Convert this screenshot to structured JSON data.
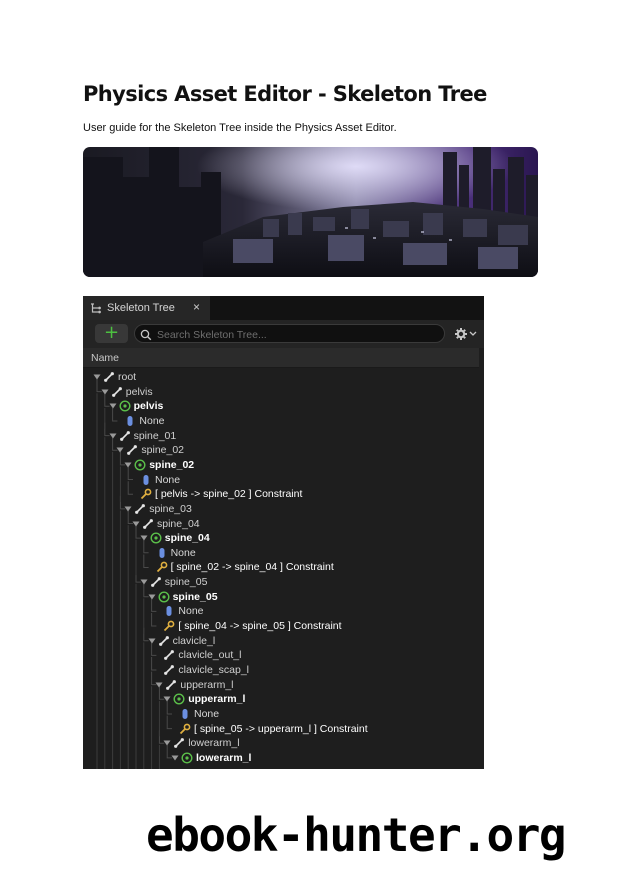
{
  "document": {
    "title": "Physics Asset Editor - Skeleton Tree",
    "subtitle": "User guide for the Skeleton Tree inside the Physics Asset Editor."
  },
  "panel": {
    "tab_label": "Skeleton Tree",
    "tab_close": "×",
    "add_label": "+",
    "search_placeholder": "Search Skeleton Tree...",
    "column_header": "Name"
  },
  "tree": [
    {
      "label": "root",
      "type": "bone",
      "depth": 0,
      "arrow": true
    },
    {
      "label": "pelvis",
      "type": "bone",
      "depth": 1,
      "arrow": true
    },
    {
      "label": "pelvis",
      "type": "body",
      "depth": 2,
      "arrow": true
    },
    {
      "label": "None",
      "type": "shape",
      "depth": 3,
      "arrow": false
    },
    {
      "label": "spine_01",
      "type": "bone",
      "depth": 2,
      "arrow": true
    },
    {
      "label": "spine_02",
      "type": "bone",
      "depth": 3,
      "arrow": true
    },
    {
      "label": "spine_02",
      "type": "body",
      "depth": 4,
      "arrow": true
    },
    {
      "label": "None",
      "type": "shape",
      "depth": 5,
      "arrow": false
    },
    {
      "label": "[ pelvis -> spine_02 ] Constraint",
      "type": "constraint",
      "depth": 5,
      "arrow": false
    },
    {
      "label": "spine_03",
      "type": "bone",
      "depth": 4,
      "arrow": true
    },
    {
      "label": "spine_04",
      "type": "bone",
      "depth": 5,
      "arrow": true
    },
    {
      "label": "spine_04",
      "type": "body",
      "depth": 6,
      "arrow": true
    },
    {
      "label": "None",
      "type": "shape",
      "depth": 7,
      "arrow": false
    },
    {
      "label": "[ spine_02 -> spine_04 ] Constraint",
      "type": "constraint",
      "depth": 7,
      "arrow": false
    },
    {
      "label": "spine_05",
      "type": "bone",
      "depth": 6,
      "arrow": true
    },
    {
      "label": "spine_05",
      "type": "body",
      "depth": 7,
      "arrow": true
    },
    {
      "label": "None",
      "type": "shape",
      "depth": 8,
      "arrow": false
    },
    {
      "label": "[ spine_04 -> spine_05 ] Constraint",
      "type": "constraint",
      "depth": 8,
      "arrow": false
    },
    {
      "label": "clavicle_l",
      "type": "bone",
      "depth": 7,
      "arrow": true
    },
    {
      "label": "clavicle_out_l",
      "type": "bone",
      "depth": 8,
      "arrow": false
    },
    {
      "label": "clavicle_scap_l",
      "type": "bone",
      "depth": 8,
      "arrow": false
    },
    {
      "label": "upperarm_l",
      "type": "bone",
      "depth": 8,
      "arrow": true
    },
    {
      "label": "upperarm_l",
      "type": "body",
      "depth": 9,
      "arrow": true
    },
    {
      "label": "None",
      "type": "shape",
      "depth": 10,
      "arrow": false
    },
    {
      "label": "[ spine_05 -> upperarm_l ] Constraint",
      "type": "constraint",
      "depth": 10,
      "arrow": false
    },
    {
      "label": "lowerarm_l",
      "type": "bone",
      "depth": 9,
      "arrow": true
    },
    {
      "label": "lowerarm_l",
      "type": "body",
      "depth": 10,
      "arrow": true
    }
  ],
  "watermark": "ebook-hunter.org",
  "colors": {
    "panel_bg": "#1e1e1e",
    "add_green": "#4cc040",
    "body_icon_green": "#5bbf4a",
    "shape_icon_blue": "#6b8fe0",
    "constraint_icon_yellow": "#e0b040"
  },
  "icons": {
    "tab": "skeleton-tree-icon",
    "search": "search-icon",
    "settings": "gear-icon",
    "bone": "bone-icon",
    "body": "physics-body-icon",
    "shape": "capsule-shape-icon",
    "constraint": "constraint-icon"
  }
}
